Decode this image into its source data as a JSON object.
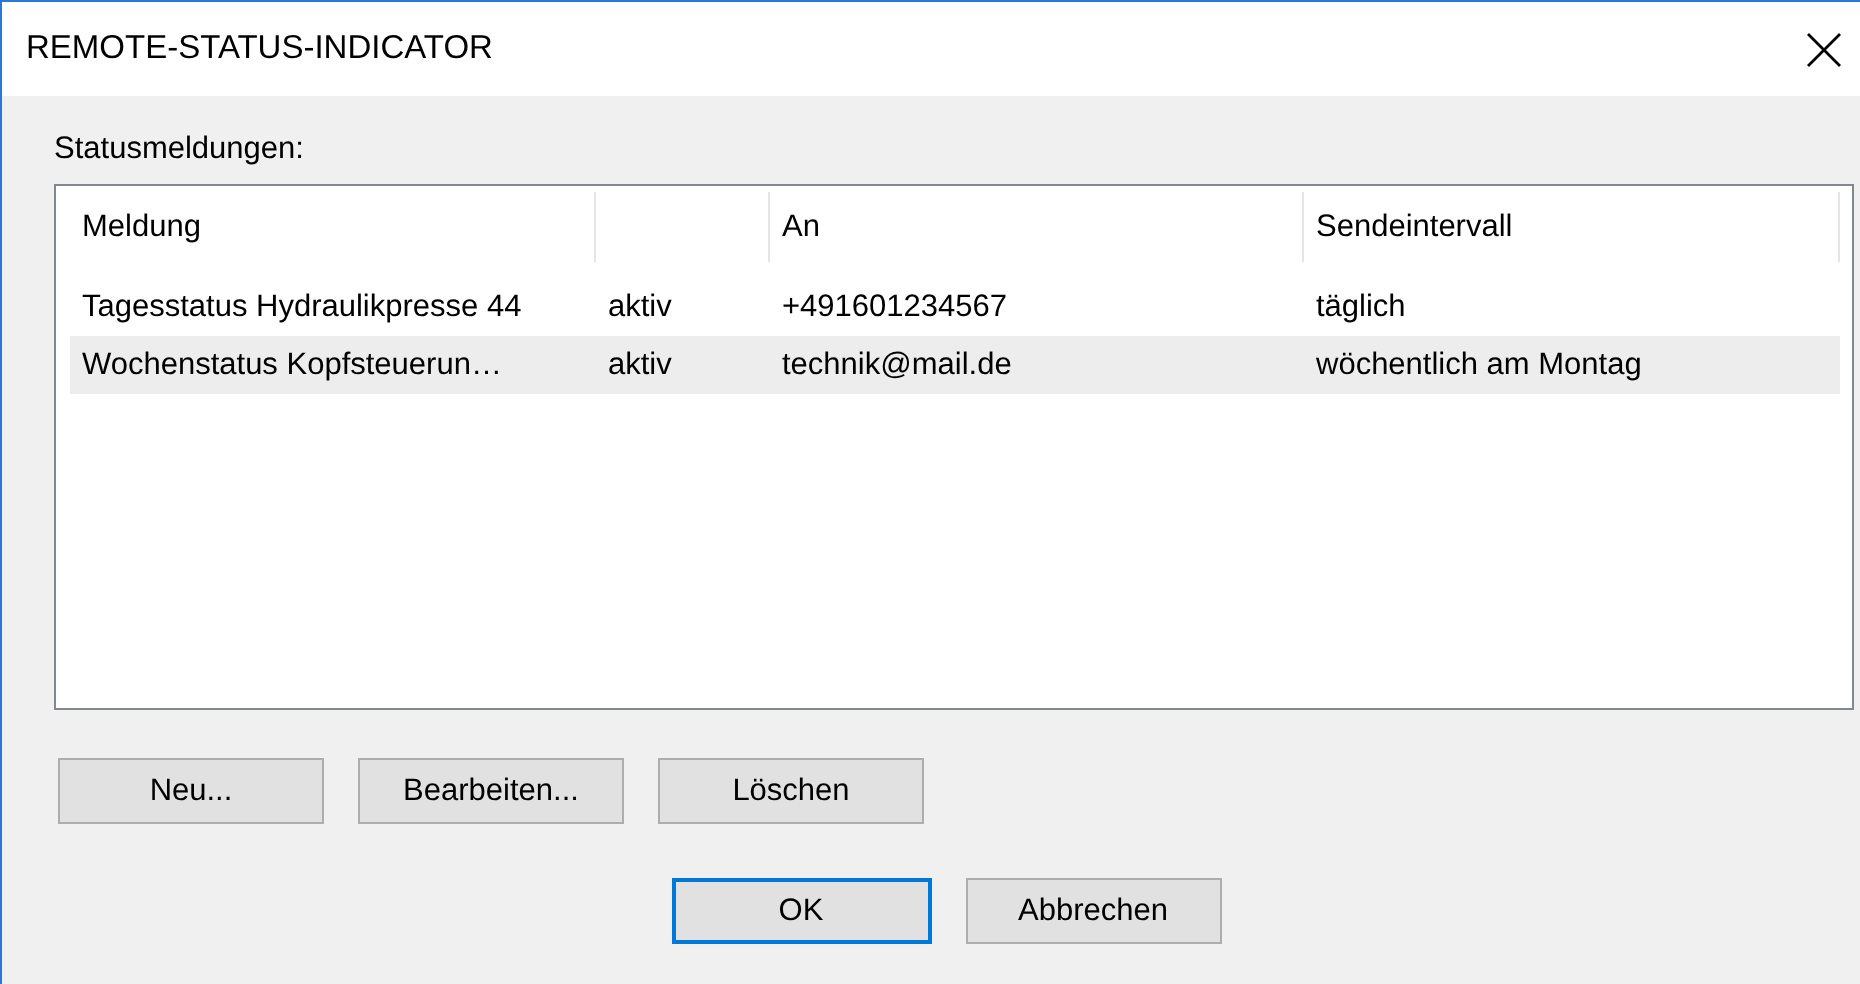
{
  "window": {
    "title": "REMOTE-STATUS-INDICATOR"
  },
  "list_label": "Statusmeldungen:",
  "table": {
    "columns": [
      "Meldung",
      "",
      "An",
      "Sendeintervall"
    ],
    "rows": [
      {
        "cells": [
          "Tagesstatus Hydraulikpresse 44",
          "aktiv",
          "+491601234567",
          "täglich"
        ],
        "selected": false
      },
      {
        "cells": [
          "Wochenstatus Kopfsteuerun…",
          "aktiv",
          "technik@mail.de",
          "wöchentlich am Montag"
        ],
        "selected": true
      }
    ]
  },
  "action_buttons": [
    "Neu...",
    "Bearbeiten...",
    "Löschen"
  ],
  "dialog_buttons": [
    {
      "label": "OK",
      "default": true
    },
    {
      "label": "Abbrechen",
      "default": false
    }
  ]
}
